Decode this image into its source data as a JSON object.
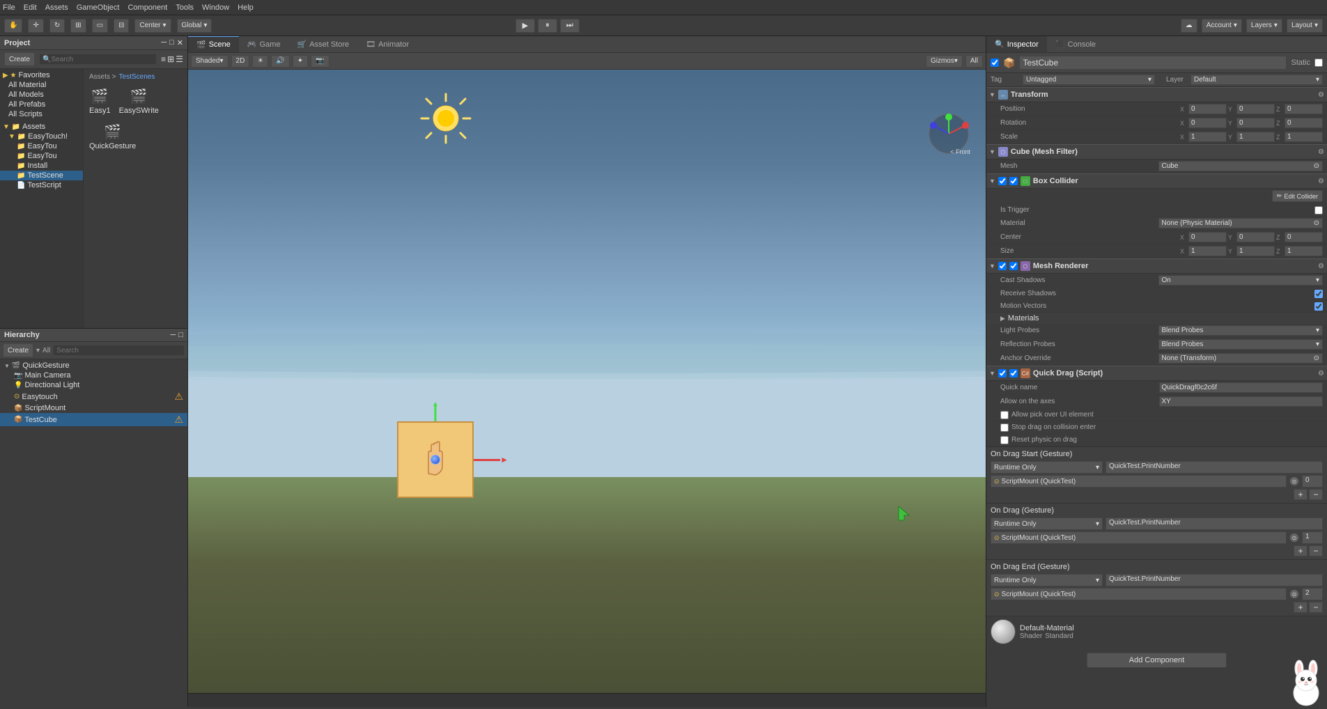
{
  "menubar": {
    "items": [
      "File",
      "Edit",
      "Assets",
      "GameObject",
      "Component",
      "Tools",
      "Window",
      "Help"
    ]
  },
  "toolbar": {
    "center_btn": "Center",
    "global_btn": "Global",
    "account_label": "Account",
    "layers_label": "Layers",
    "layout_label": "Layout"
  },
  "project_panel": {
    "title": "Project",
    "create_btn": "Create",
    "favorites": {
      "label": "Favorites",
      "items": [
        "All Material",
        "All Models",
        "All Prefabs",
        "All Scripts"
      ]
    },
    "assets": {
      "label": "Assets",
      "items": [
        "EasyTouch!",
        "EasyTou",
        "EasyTou",
        "Install",
        "TestScene",
        "TestScript"
      ]
    },
    "test_scenes": {
      "label": "TestScenes",
      "items": [
        "Easy1",
        "EasySWrite",
        "QuickGesture"
      ]
    }
  },
  "hierarchy_panel": {
    "title": "Hierarchy",
    "create_btn": "Create",
    "all_label": "All",
    "items": [
      {
        "label": "QuickGesture",
        "level": 0,
        "has_children": true
      },
      {
        "label": "Main Camera",
        "level": 1,
        "has_children": false
      },
      {
        "label": "Directional Light",
        "level": 1,
        "has_children": false
      },
      {
        "label": "Easytouch",
        "level": 1,
        "has_children": false
      },
      {
        "label": "ScriptMount",
        "level": 1,
        "has_children": false
      },
      {
        "label": "TestCube",
        "level": 1,
        "has_children": false,
        "selected": true
      }
    ]
  },
  "scene": {
    "title": "Scene",
    "game_tab": "Game",
    "asset_store_tab": "Asset Store",
    "animator_tab": "Animator",
    "shaded_dropdown": "Shaded",
    "mode_2d": "2D",
    "gizmos_btn": "Gizmos",
    "all_dropdown": "All",
    "front_label": "< Front"
  },
  "inspector": {
    "title": "Inspector",
    "console_tab": "Console",
    "object_name": "TestCube",
    "static_label": "Static",
    "tag_label": "Tag",
    "tag_value": "Untagged",
    "layer_label": "Layer",
    "layer_value": "Default",
    "transform": {
      "title": "Transform",
      "position_label": "Position",
      "rotation_label": "Rotation",
      "scale_label": "Scale",
      "pos_x": "0",
      "pos_y": "0",
      "pos_z": "0",
      "rot_x": "0",
      "rot_y": "0",
      "rot_z": "0",
      "scale_x": "1",
      "scale_y": "1",
      "scale_z": "1"
    },
    "mesh_filter": {
      "title": "Cube (Mesh Filter)",
      "mesh_label": "Mesh",
      "mesh_value": "Cube"
    },
    "box_collider": {
      "title": "Box Collider",
      "edit_btn": "Edit Collider",
      "is_trigger_label": "Is Trigger",
      "material_label": "Material",
      "material_value": "None (Physic Material)",
      "center_label": "Center",
      "center_x": "0",
      "center_y": "0",
      "center_z": "0",
      "size_label": "Size",
      "size_x": "1",
      "size_y": "1",
      "size_z": "1"
    },
    "mesh_renderer": {
      "title": "Mesh Renderer",
      "cast_shadows_label": "Cast Shadows",
      "cast_shadows_value": "On",
      "receive_shadows_label": "Receive Shadows",
      "motion_vectors_label": "Motion Vectors",
      "materials_label": "Materials",
      "light_probes_label": "Light Probes",
      "light_probes_value": "Blend Probes",
      "reflection_probes_label": "Reflection Probes",
      "reflection_probes_value": "Blend Probes",
      "anchor_override_label": "Anchor Override",
      "anchor_override_value": "None (Transform)"
    },
    "quick_drag": {
      "title": "Quick Drag (Script)",
      "quick_name_label": "Quick name",
      "quick_name_value": "QuickDragf0c2c6f",
      "allow_axes_label": "Allow on the axes",
      "allow_axes_value": "XY",
      "pick_ui_label": "Allow pick over UI element",
      "stop_collision_label": "Stop drag on collision enter",
      "reset_physic_label": "Reset physic on drag",
      "on_drag_start_label": "On Drag Start (Gesture)",
      "on_drag_label": "On Drag (Gesture)",
      "on_drag_end_label": "On Drag End (Gesture)",
      "runtime_only": "Runtime Only",
      "print_number": "QuickTest.PrintNumber",
      "script_mount": "ScriptMount (QuickTest)",
      "val_0": "0",
      "val_1": "1",
      "val_2": "2"
    },
    "material": {
      "name": "Default-Material",
      "shader_label": "Shader",
      "shader_value": "Standard"
    },
    "add_component_btn": "Add Component"
  }
}
